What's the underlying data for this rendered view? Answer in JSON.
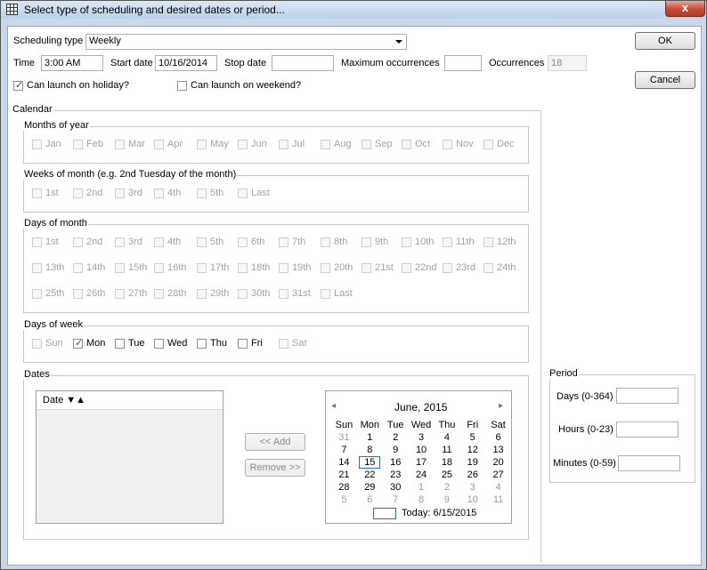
{
  "window": {
    "title": "Select type of scheduling and desired dates or period...",
    "close_label": "x"
  },
  "buttons": {
    "ok": "OK",
    "cancel": "Cancel",
    "add": "<< Add",
    "remove": "Remove >>"
  },
  "row1": {
    "scheduling_type_label": "Scheduling type",
    "scheduling_type_value": "Weekly"
  },
  "row2": {
    "time_label": "Time",
    "time_value": "3:00 AM",
    "start_label": "Start date",
    "start_value": "10/16/2014",
    "stop_label": "Stop date",
    "stop_value": "",
    "maxocc_label": "Maximum occurrences",
    "maxocc_value": "",
    "occ_label": "Occurrences",
    "occ_value": "18"
  },
  "row3": {
    "holiday_label": "Can launch on holiday?",
    "holiday_checked": true,
    "weekend_label": "Can launch on weekend?",
    "weekend_checked": false
  },
  "calendar_group": {
    "title": "Calendar",
    "months_title": "Months of year",
    "months": [
      "Jan",
      "Feb",
      "Mar",
      "Apr",
      "May",
      "Jun",
      "Jul",
      "Aug",
      "Sep",
      "Oct",
      "Nov",
      "Dec"
    ],
    "weeks_title": "Weeks of month (e.g. 2nd Tuesday of the month)",
    "weeks": [
      "1st",
      "2nd",
      "3rd",
      "4th",
      "5th",
      "Last"
    ],
    "days_title": "Days of month",
    "days": [
      "1st",
      "2nd",
      "3rd",
      "4th",
      "5th",
      "6th",
      "7th",
      "8th",
      "9th",
      "10th",
      "11th",
      "12th",
      "13th",
      "14th",
      "15th",
      "16th",
      "17th",
      "18th",
      "19th",
      "20th",
      "21st",
      "22nd",
      "23rd",
      "24th",
      "25th",
      "26th",
      "27th",
      "28th",
      "29th",
      "30th",
      "31st",
      "Last"
    ],
    "dow_title": "Days of week",
    "dow": [
      {
        "label": "Sun",
        "checked": false,
        "enabled": false
      },
      {
        "label": "Mon",
        "checked": true,
        "enabled": true
      },
      {
        "label": "Tue",
        "checked": false,
        "enabled": true
      },
      {
        "label": "Wed",
        "checked": false,
        "enabled": true
      },
      {
        "label": "Thu",
        "checked": false,
        "enabled": true
      },
      {
        "label": "Fri",
        "checked": false,
        "enabled": true
      },
      {
        "label": "Sat",
        "checked": false,
        "enabled": false
      }
    ],
    "dates_title": "Dates",
    "dates_column": "Date ▼▲"
  },
  "month_calendar": {
    "prev": "◂",
    "next": "▸",
    "month_label": "June, 2015",
    "weekdays": [
      "Sun",
      "Mon",
      "Tue",
      "Wed",
      "Thu",
      "Fri",
      "Sat"
    ],
    "weeks": [
      [
        {
          "d": "31",
          "o": true
        },
        {
          "d": "1"
        },
        {
          "d": "2"
        },
        {
          "d": "3"
        },
        {
          "d": "4"
        },
        {
          "d": "5"
        },
        {
          "d": "6"
        }
      ],
      [
        {
          "d": "7"
        },
        {
          "d": "8"
        },
        {
          "d": "9"
        },
        {
          "d": "10"
        },
        {
          "d": "11"
        },
        {
          "d": "12"
        },
        {
          "d": "13"
        }
      ],
      [
        {
          "d": "14"
        },
        {
          "d": "15",
          "sel": true
        },
        {
          "d": "16"
        },
        {
          "d": "17"
        },
        {
          "d": "18"
        },
        {
          "d": "19"
        },
        {
          "d": "20"
        }
      ],
      [
        {
          "d": "21"
        },
        {
          "d": "22"
        },
        {
          "d": "23"
        },
        {
          "d": "24"
        },
        {
          "d": "25"
        },
        {
          "d": "26"
        },
        {
          "d": "27"
        }
      ],
      [
        {
          "d": "28"
        },
        {
          "d": "29"
        },
        {
          "d": "30"
        },
        {
          "d": "1",
          "o": true
        },
        {
          "d": "2",
          "o": true
        },
        {
          "d": "3",
          "o": true
        },
        {
          "d": "4",
          "o": true
        }
      ],
      [
        {
          "d": "5",
          "o": true
        },
        {
          "d": "6",
          "o": true
        },
        {
          "d": "7",
          "o": true
        },
        {
          "d": "8",
          "o": true
        },
        {
          "d": "9",
          "o": true
        },
        {
          "d": "10",
          "o": true
        },
        {
          "d": "11",
          "o": true
        }
      ]
    ],
    "today_label": "Today: 6/15/2015"
  },
  "period": {
    "title": "Period",
    "days_label": "Days (0-364)",
    "days_value": "",
    "hours_label": "Hours (0-23)",
    "hours_value": "",
    "minutes_label": "Minutes (0-59)",
    "minutes_value": ""
  }
}
